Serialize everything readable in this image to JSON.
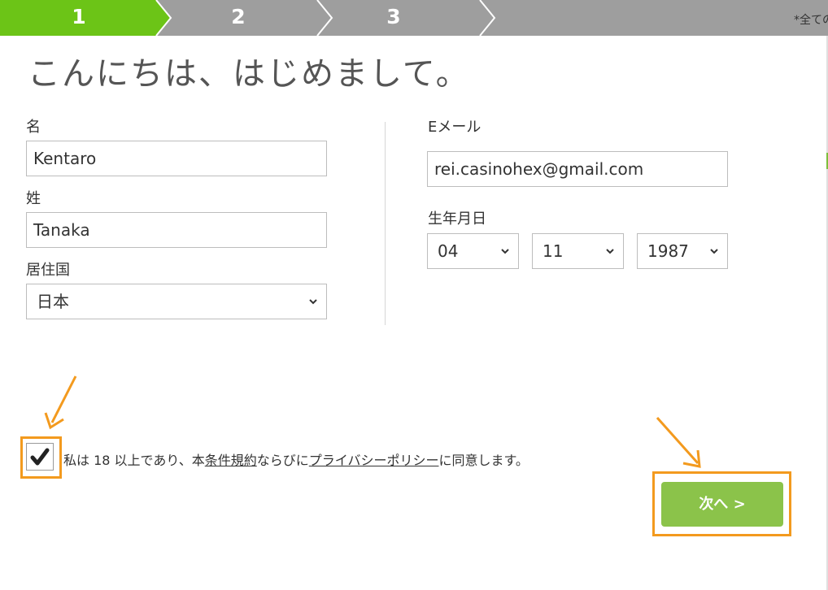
{
  "steps": [
    {
      "label": "1",
      "state": "active"
    },
    {
      "label": "2",
      "state": "inactive"
    },
    {
      "label": "3",
      "state": "inactive"
    }
  ],
  "required_note": "*全ての",
  "title": "こんにちは、はじめまして。",
  "form": {
    "first_name_label": "名",
    "first_name_value": "Kentaro",
    "last_name_label": "姓",
    "last_name_value": "Tanaka",
    "country_label": "居住国",
    "country_value": "日本",
    "email_label": "Eメール",
    "email_value": "rei.casinohex@gmail.com",
    "dob_label": "生年月日",
    "dob_month": "04",
    "dob_day": "11",
    "dob_year": "1987"
  },
  "consent": {
    "checked": true,
    "text_before": "私は 18 以上であり、本",
    "terms_link": "条件規約",
    "text_middle": "ならびに",
    "privacy_link": "プライバシーポリシー",
    "text_after": "に同意します。"
  },
  "next_label": "次へ >",
  "colors": {
    "step_active": "#6cc417",
    "step_inactive": "#9e9e9e",
    "next_button": "#8bc34a",
    "annotation": "#f39a1e"
  },
  "icons": {
    "dropdown": "chevron-down-icon",
    "check": "checkmark-icon",
    "annotation_arrow": "arrow-icon"
  }
}
